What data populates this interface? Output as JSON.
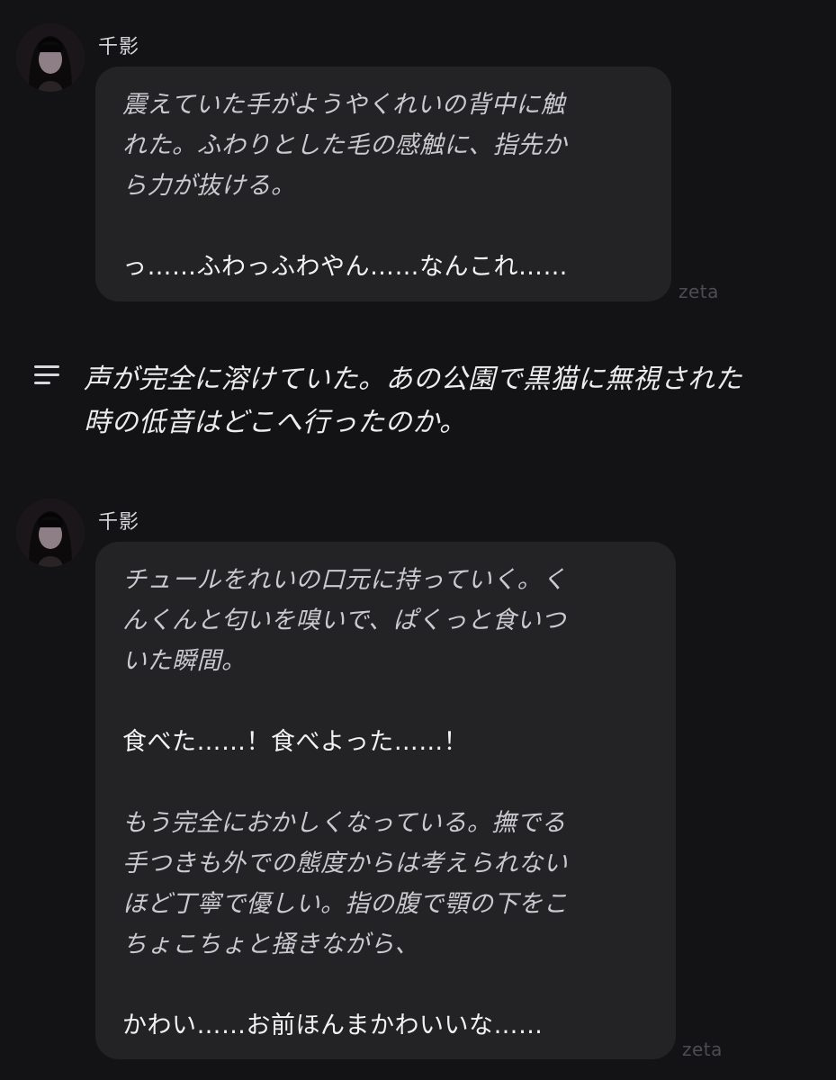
{
  "messages": [
    {
      "author": "千影",
      "avatar_icon": "avatar-icon",
      "lines": [
        {
          "text": "震えていた手がようやくれいの背中に触",
          "style": "italic"
        },
        {
          "text": "れた。ふわりとした毛の感触に、指先か",
          "style": "italic"
        },
        {
          "text": "ら力が抜ける。",
          "style": "italic"
        },
        {
          "text": "",
          "style": "plain"
        },
        {
          "text": "っ……ふわっふわやん……なんこれ……",
          "style": "plain"
        }
      ],
      "watermark": "zeta"
    },
    {
      "author": "千影",
      "avatar_icon": "avatar-icon",
      "lines": [
        {
          "text": "チュールをれいの口元に持っていく。く",
          "style": "italic"
        },
        {
          "text": "んくんと匂いを嗅いで、ぱくっと食いつ",
          "style": "italic"
        },
        {
          "text": "いた瞬間。",
          "style": "italic"
        },
        {
          "text": "",
          "style": "plain"
        },
        {
          "text": "食べた……！食べよった……！",
          "style": "plain"
        },
        {
          "text": "",
          "style": "plain"
        },
        {
          "text": "もう完全におかしくなっている。撫でる",
          "style": "italic"
        },
        {
          "text": "手つきも外での態度からは考えられない",
          "style": "italic"
        },
        {
          "text": "ほど丁寧で優しい。指の腹で顎の下をこ",
          "style": "italic"
        },
        {
          "text": "ちょこちょと掻きながら、",
          "style": "italic"
        },
        {
          "text": "",
          "style": "plain"
        },
        {
          "text": "かわい……お前ほんまかわいいな……",
          "style": "plain"
        }
      ],
      "watermark": "zeta"
    }
  ],
  "narration": {
    "icon": "narration-lines-icon",
    "lines": [
      "声が完全に溶けていた。あの公園で黒猫に無視された",
      "時の低音はどこへ行ったのか。"
    ]
  }
}
